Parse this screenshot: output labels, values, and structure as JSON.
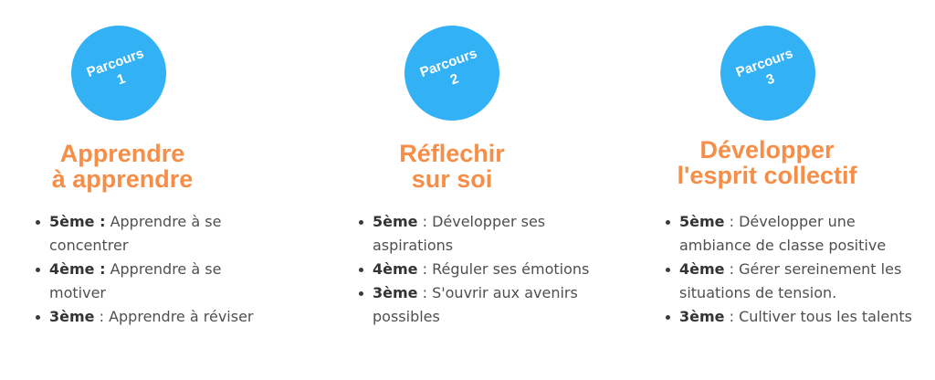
{
  "colors": {
    "badge": "#33b1f5",
    "title": "#f78e48",
    "text": "#4f4f4f"
  },
  "parcours": [
    {
      "badge": {
        "word": "Parcours",
        "number": "1"
      },
      "title": {
        "line1": "Apprendre",
        "line2": "à apprendre"
      },
      "items": [
        {
          "level": "5ème :",
          "sep": " ",
          "text": "Apprendre à se concentrer"
        },
        {
          "level": "4ème :",
          "sep": " ",
          "text": "Apprendre à se motiver"
        },
        {
          "level": "3ème",
          "sep": " : ",
          "text": "Apprendre à réviser"
        }
      ]
    },
    {
      "badge": {
        "word": "Parcours",
        "number": "2"
      },
      "title": {
        "line1": "Réflechir",
        "line2": "sur soi"
      },
      "items": [
        {
          "level": "5ème",
          "sep": " : ",
          "text": "Développer ses aspirations"
        },
        {
          "level": "4ème",
          "sep": " : ",
          "text": "Réguler ses émotions"
        },
        {
          "level": "3ème",
          "sep": " : ",
          "text": "S'ouvrir aux avenirs possibles"
        }
      ]
    },
    {
      "badge": {
        "word": "Parcours",
        "number": "3"
      },
      "title": {
        "line1": "Développer",
        "line2": "l'esprit collectif"
      },
      "items": [
        {
          "level": "5ème",
          "sep": " : ",
          "text": "Développer une ambiance de classe positive"
        },
        {
          "level": "4ème",
          "sep": " : ",
          "text": "Gérer sereinement les situations de tension."
        },
        {
          "level": "3ème",
          "sep": " : ",
          "text": "Cultiver tous les talents"
        }
      ]
    }
  ]
}
